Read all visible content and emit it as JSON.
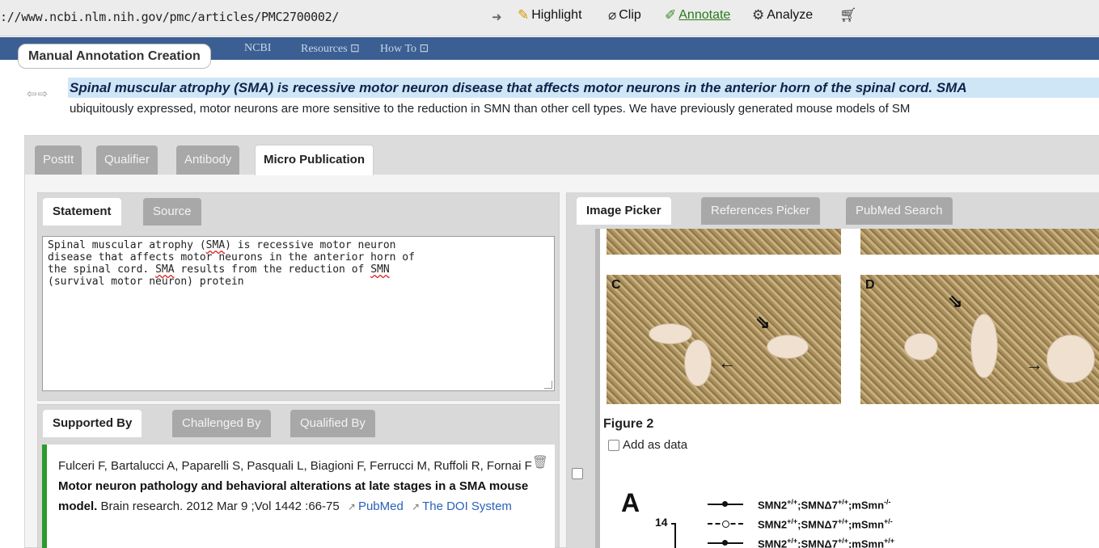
{
  "browser": {
    "url": "://www.ncbi.nlm.nih.gov/pmc/articles/PMC2700002/",
    "tools": [
      {
        "name": "highlight",
        "label": "Highlight",
        "icon": "highlighter-icon"
      },
      {
        "name": "clip",
        "label": "Clip",
        "icon": "paperclip-icon"
      },
      {
        "name": "annotate",
        "label": "Annotate",
        "icon": "pencil-icon",
        "active": true
      },
      {
        "name": "analyze",
        "label": "Analyze",
        "icon": "gears-icon"
      },
      {
        "name": "save",
        "label": "",
        "icon": "cart-icon"
      }
    ]
  },
  "ncbi": {
    "logo_fragment": "NCBI",
    "menu": [
      "Resources",
      "How To"
    ]
  },
  "annotation_pill": "Manual Annotation Creation",
  "sentence": {
    "highlighted": "Spinal muscular atrophy (SMA) is recessive motor neuron disease that affects motor neurons in the anterior horn of the spinal cord. SMA",
    "continuation": "ubiquitously expressed, motor neurons are more sensitive to the reduction in SMN than other cell types. We have previously generated mouse models of SM"
  },
  "main_tabs": [
    "PostIt",
    "Qualifier",
    "Antibody",
    "Micro Publication"
  ],
  "statement_tabs": [
    "Statement",
    "Source"
  ],
  "statement_text": {
    "line1_a": "Spinal muscular atrophy (",
    "line1_sma": "SMA",
    "line1_b": ") is recessive motor neuron",
    "line2": "disease that affects motor neurons in the anterior horn of",
    "line3_a": "the spinal cord. ",
    "line3_sma": "SMA",
    "line3_b": " results from the reduction of ",
    "line3_smn": "SMN",
    "line4": "(survival motor neuron) protein"
  },
  "support_tabs": [
    "Supported By",
    "Challenged By",
    "Qualified By"
  ],
  "reference": {
    "authors": "Fulceri F, Bartalucci A, Paparelli S, Pasquali L, Biagioni F, Ferrucci M, Ruffoli R, Fornai F",
    "title": "Motor neuron pathology and behavioral alterations at late stages in a SMA mouse model.",
    "journal": "Brain research.",
    "date": "2012 Mar 9 ;Vol 1442 :66-75",
    "link1": "PubMed",
    "link2": "The DOI System"
  },
  "picker_tabs": [
    "Image Picker",
    "References Picker",
    "PubMed Search"
  ],
  "figure": {
    "panel_c": "C",
    "panel_d": "D",
    "title": "Figure 2",
    "add_label": "Add as data",
    "graph_label": "A",
    "y_tick": "14",
    "legend": [
      {
        "text": "SMN2",
        "sup1": "+/+",
        "mid": ";SMNΔ7",
        "sup2": "+/+",
        "tail": ";mSmn",
        "sup3": "-/-"
      },
      {
        "text": "SMN2",
        "sup1": "+/+",
        "mid": ";SMNΔ7",
        "sup2": "+/+",
        "tail": ";mSmn",
        "sup3": "+/-"
      },
      {
        "text": "SMN2",
        "sup1": "+/+",
        "mid": ";SMNΔ7",
        "sup2": "+/+",
        "tail": ";mSmn",
        "sup3": "+/+"
      }
    ]
  },
  "colors": {
    "ncbi_blue": "#3c5f93",
    "highlight": "#cfe6f7",
    "support_bar": "#2c9a2c",
    "link": "#2a62b8"
  }
}
